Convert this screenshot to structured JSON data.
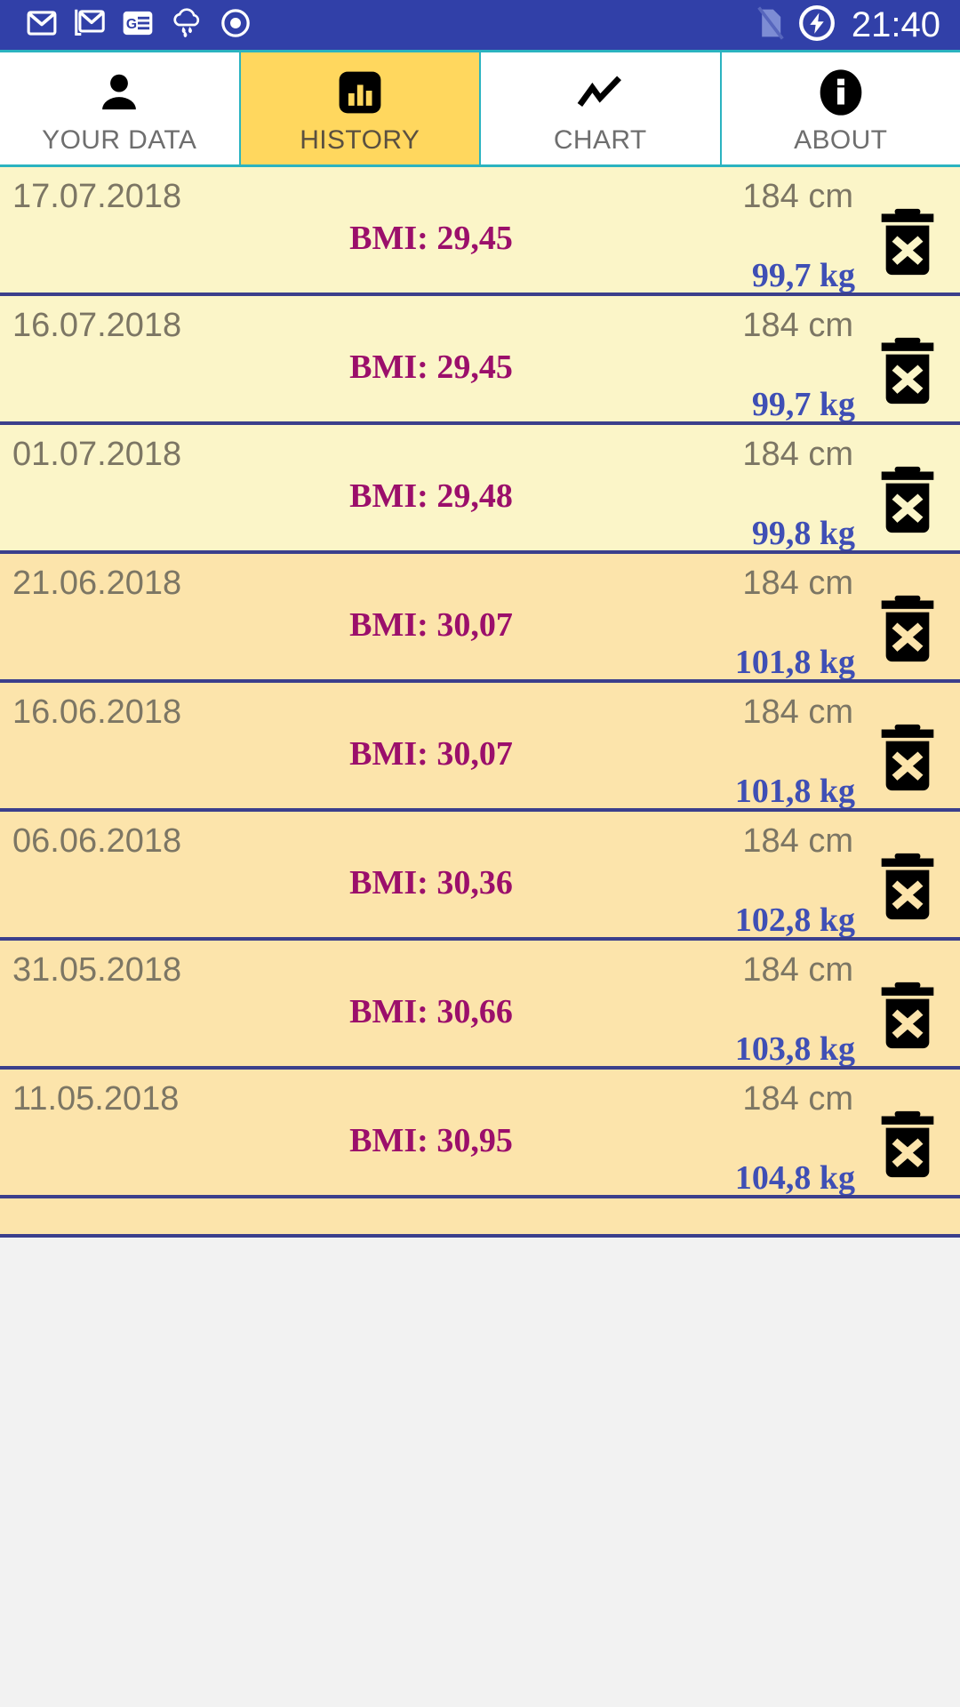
{
  "statusbar": {
    "time": "21:40",
    "left_icons": [
      "gmail-icon",
      "gmail-secondary-icon",
      "google-news-icon",
      "weather-rain-icon",
      "record-circle-icon"
    ],
    "right_icons": [
      "no-sim-card-icon",
      "battery-charging-icon"
    ],
    "background_color": "#3140a8"
  },
  "tabs": [
    {
      "label": "YOUR DATA",
      "icon": "person-icon",
      "active": false
    },
    {
      "label": "HISTORY",
      "icon": "bar-chart-icon",
      "active": true
    },
    {
      "label": "CHART",
      "icon": "line-chart-icon",
      "active": false
    },
    {
      "label": "ABOUT",
      "icon": "info-icon",
      "active": false
    }
  ],
  "theme": {
    "accent": "#ffd75e",
    "tab_border": "#2bb3c0",
    "row_divider": "#3b3f8c",
    "bmi_color": "#9b0f6b",
    "weight_color": "#3f4fb5",
    "date_color": "#7c7664",
    "row_shade_light": "#fbf5c8",
    "row_shade_dark": "#fce4ab"
  },
  "history": {
    "rows": [
      {
        "date": "17.07.2018",
        "height": "184 cm",
        "bmi": "BMI: 29,45",
        "weight": "99,7 kg",
        "shade": "shade-a",
        "delete_icon": "delete-trash-icon"
      },
      {
        "date": "16.07.2018",
        "height": "184 cm",
        "bmi": "BMI: 29,45",
        "weight": "99,7 kg",
        "shade": "shade-a",
        "delete_icon": "delete-trash-icon"
      },
      {
        "date": "01.07.2018",
        "height": "184 cm",
        "bmi": "BMI: 29,48",
        "weight": "99,8 kg",
        "shade": "shade-a",
        "delete_icon": "delete-trash-icon"
      },
      {
        "date": "21.06.2018",
        "height": "184 cm",
        "bmi": "BMI: 30,07",
        "weight": "101,8 kg",
        "shade": "shade-b",
        "delete_icon": "delete-trash-icon"
      },
      {
        "date": "16.06.2018",
        "height": "184 cm",
        "bmi": "BMI: 30,07",
        "weight": "101,8 kg",
        "shade": "shade-b",
        "delete_icon": "delete-trash-icon"
      },
      {
        "date": "06.06.2018",
        "height": "184 cm",
        "bmi": "BMI: 30,36",
        "weight": "102,8 kg",
        "shade": "shade-b",
        "delete_icon": "delete-trash-icon"
      },
      {
        "date": "31.05.2018",
        "height": "184 cm",
        "bmi": "BMI: 30,66",
        "weight": "103,8 kg",
        "shade": "shade-b",
        "delete_icon": "delete-trash-icon"
      },
      {
        "date": "11.05.2018",
        "height": "184 cm",
        "bmi": "BMI: 30,95",
        "weight": "104,8 kg",
        "shade": "shade-b",
        "delete_icon": "delete-trash-icon"
      }
    ]
  }
}
